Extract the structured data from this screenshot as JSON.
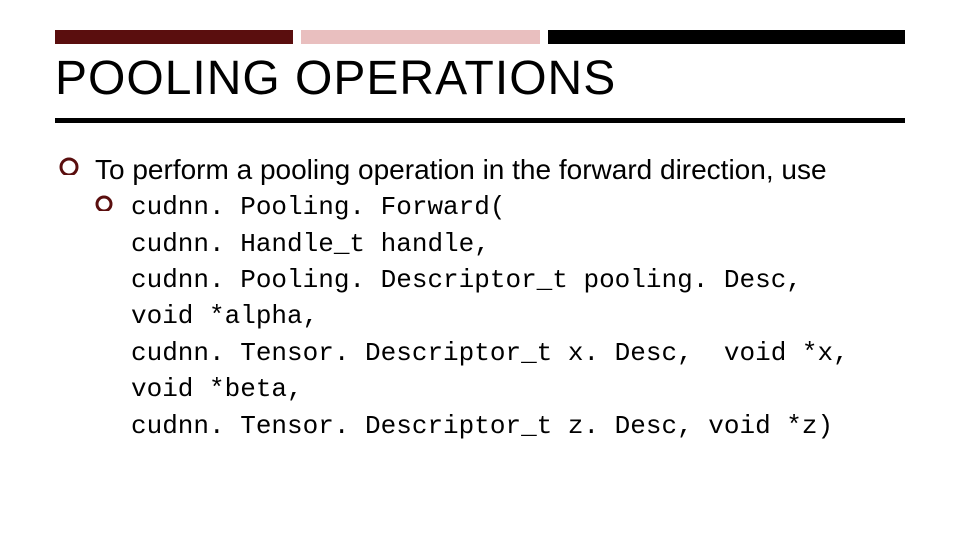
{
  "colors": {
    "accent_dark": "#5a0e0e",
    "accent_light": "#e9bfbf",
    "black": "#000000"
  },
  "title": "POOLING OPERATIONS",
  "bullet1_text": "To perform a pooling operation in the forward direction, use",
  "code_text": "cudnn. Pooling. Forward(\ncudnn. Handle_t handle,\ncudnn. Pooling. Descriptor_t pooling. Desc,\nvoid *alpha,\ncudnn. Tensor. Descriptor_t x. Desc,  void *x,\nvoid *beta,\ncudnn. Tensor. Descriptor_t z. Desc, void *z)"
}
